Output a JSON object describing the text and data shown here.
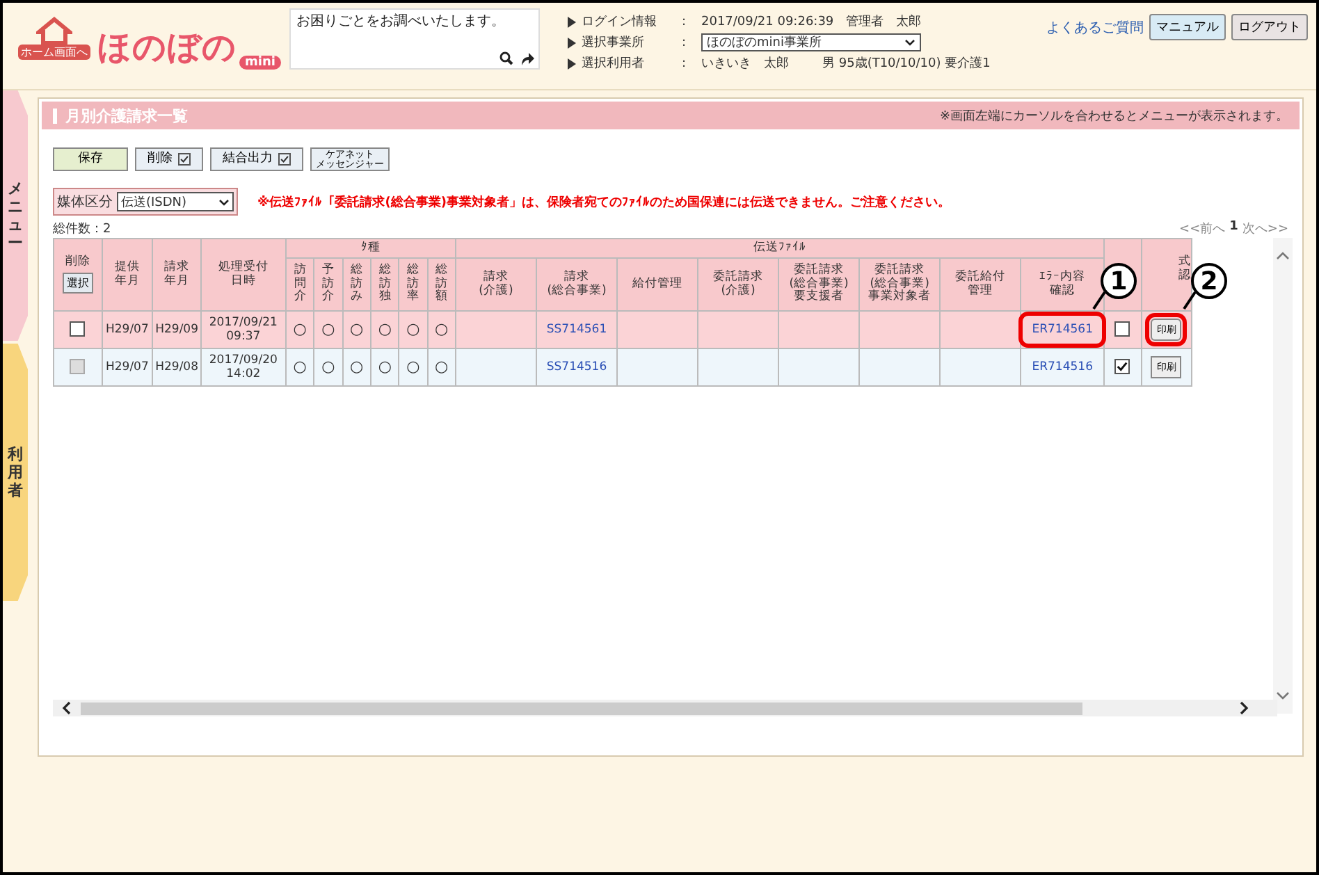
{
  "header": {
    "home_label": "ホーム画面へ",
    "logo_text": "ほのぼの",
    "logo_badge": "mini",
    "search": {
      "placeholder": "お困りごとをお調べいたします。"
    },
    "info": [
      {
        "kind": "text",
        "label": "ログイン情報",
        "sep": ":",
        "value": "2017/09/21 09:26:39　管理者　太郎"
      },
      {
        "kind": "select",
        "label": "選択事業所",
        "sep": ":",
        "value": "ほのぼのmini事業所"
      },
      {
        "kind": "user",
        "label": "選択利用者",
        "sep": ":",
        "value": "いきいき　太郎",
        "extra": "男 95歳(T10/10/10) 要介護1"
      }
    ],
    "faq_link": "よくあるご質問",
    "buttons": [
      {
        "label": "マニュアル",
        "kind": "blue"
      },
      {
        "label": "ログアウト",
        "kind": "grey"
      }
    ]
  },
  "side_tabs": [
    {
      "label": "メニュー",
      "kind": "menu"
    },
    {
      "label": "利用者",
      "kind": "user"
    }
  ],
  "panel": {
    "title": "月別介護請求一覧",
    "note": "※画面左端にカーソルを合わせるとメニューが表示されます。"
  },
  "toolbar": [
    {
      "label": "保存",
      "kind": "save",
      "checkbox": false
    },
    {
      "label": "削除",
      "kind": "plain",
      "checkbox": true
    },
    {
      "label": "結合出力",
      "kind": "plain",
      "checkbox": true
    },
    {
      "label_lines": [
        "ケアネット",
        "メッセンジャー"
      ],
      "kind": "small",
      "checkbox": false
    }
  ],
  "media": {
    "label": "媒体区分",
    "value": "伝送(ISDN)"
  },
  "warning": "※伝送ﾌｧｲﾙ「委託請求(総合事業)事業対象者」は、保険者宛てのﾌｧｲﾙのため国保連には伝送できません。ご注意ください。",
  "total": "総件数：2",
  "pager": {
    "prev": "<<前へ",
    "page": "1",
    "next": "次へ>>"
  },
  "table": {
    "delete_header": "削除",
    "select_button": "選択",
    "columns": [
      "提供年月",
      "請求年月",
      "処理受付日時"
    ],
    "service_group": "ﾀ種",
    "service_columns": [
      "訪問介",
      "予訪介",
      "総訪み",
      "総訪独",
      "総訪率",
      "総訪額"
    ],
    "file_group": "伝送ﾌｧｲﾙ",
    "file_columns": [
      "請求\n(介護)",
      "請求\n(総合事業)",
      "給付管理",
      "委託請求\n(介護)",
      "委託請求\n(総合事業)\n要支援者",
      "委託請求\n(総合事業)\n事業対象者",
      "委託給付管理"
    ],
    "error_column": "ｴﾗｰ内容確認",
    "form_column": "式認",
    "rows": [
      {
        "selected": true,
        "delete_checked": false,
        "delete_disabled": false,
        "cells": [
          "H29/07",
          "H29/09",
          "2017/09/21\n09:37"
        ],
        "services": [
          "○",
          "○",
          "○",
          "○",
          "○",
          "○"
        ],
        "general_request_file": "SS714561",
        "error": "ER714561",
        "confirm_checked": false,
        "print": "印刷",
        "error_highlight": true,
        "print_highlight": true
      },
      {
        "selected": false,
        "delete_checked": false,
        "delete_disabled": true,
        "cells": [
          "H29/07",
          "H29/08",
          "2017/09/20\n14:02"
        ],
        "services": [
          "○",
          "○",
          "○",
          "○",
          "○",
          "○"
        ],
        "general_request_file": "SS714516",
        "error": "ER714516",
        "confirm_checked": true,
        "print": "印刷",
        "error_highlight": false,
        "print_highlight": false
      }
    ]
  },
  "callouts": [
    "1",
    "2"
  ]
}
